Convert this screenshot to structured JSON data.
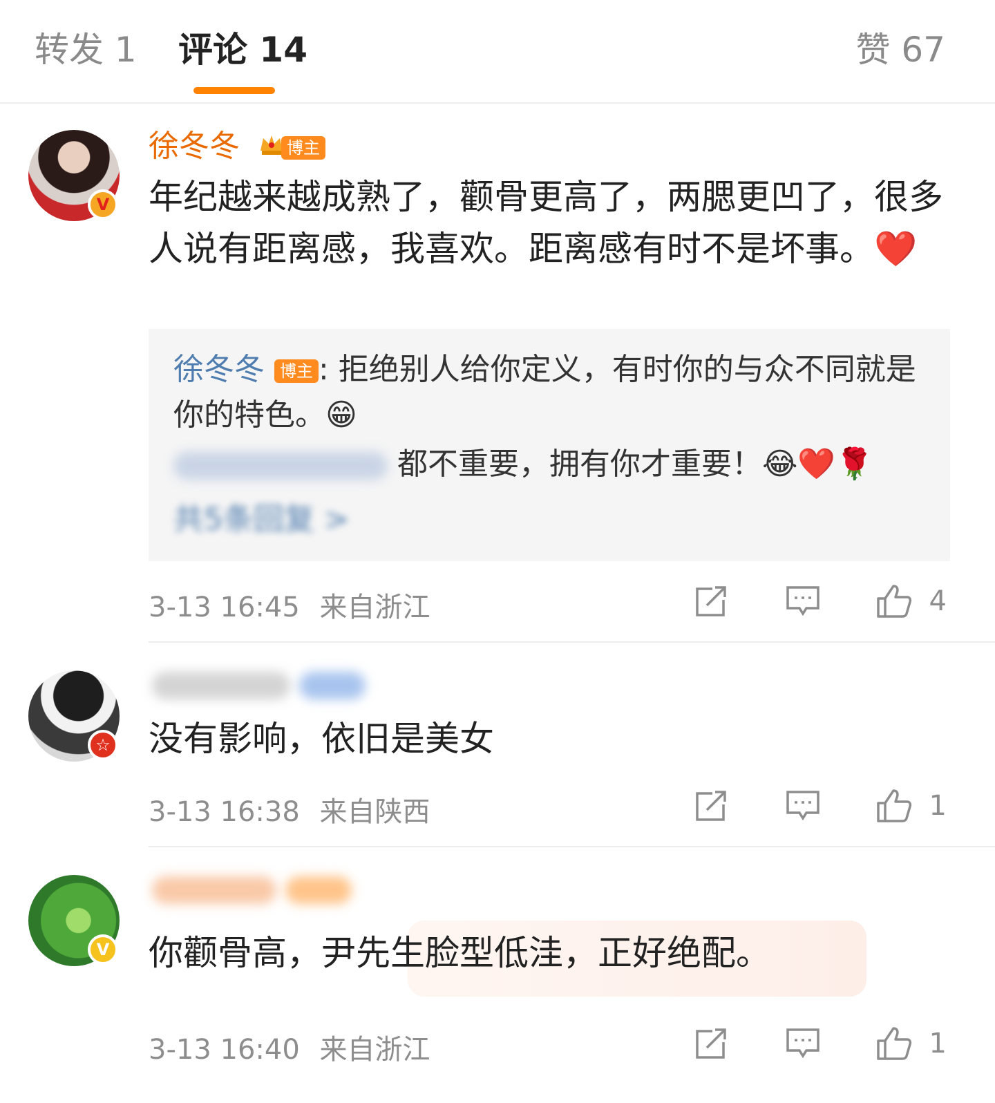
{
  "tabs": {
    "repost": "转发 1",
    "comments": "评论 14",
    "likes": "赞 67"
  },
  "comments": [
    {
      "username": "徐冬冬",
      "badge_label": "博主",
      "badge_icon": "crown-icon",
      "verified": "V",
      "text": "年纪越来越成熟了，颧骨更高了，两腮更凹了，很多人说有距离感，我喜欢。距离感有时不是坏事。❤️",
      "reply": {
        "author": "徐冬冬",
        "author_badge": "博主",
        "text": ": 拒绝别人给你定义，有时你的与众不同就是你的特色。😁",
        "second_text": "都不重要，拥有你才重要！😂❤️🌹",
        "more_replies": "共5条回复 >"
      },
      "timestamp": "3-13 16:45",
      "location": "来自浙江",
      "likes": "4"
    },
    {
      "verified": "☆",
      "text": "没有影响，依旧是美女",
      "timestamp": "3-13 16:38",
      "location": "来自陕西",
      "likes": "1"
    },
    {
      "verified": "V",
      "text": "你颧骨高，尹先生脸型低洼，正好绝配。",
      "timestamp": "3-13 16:40",
      "location": "来自浙江",
      "likes": "1"
    }
  ],
  "colors": {
    "accent": "#ff8200",
    "link": "#507daf",
    "username": "#e86a00"
  }
}
